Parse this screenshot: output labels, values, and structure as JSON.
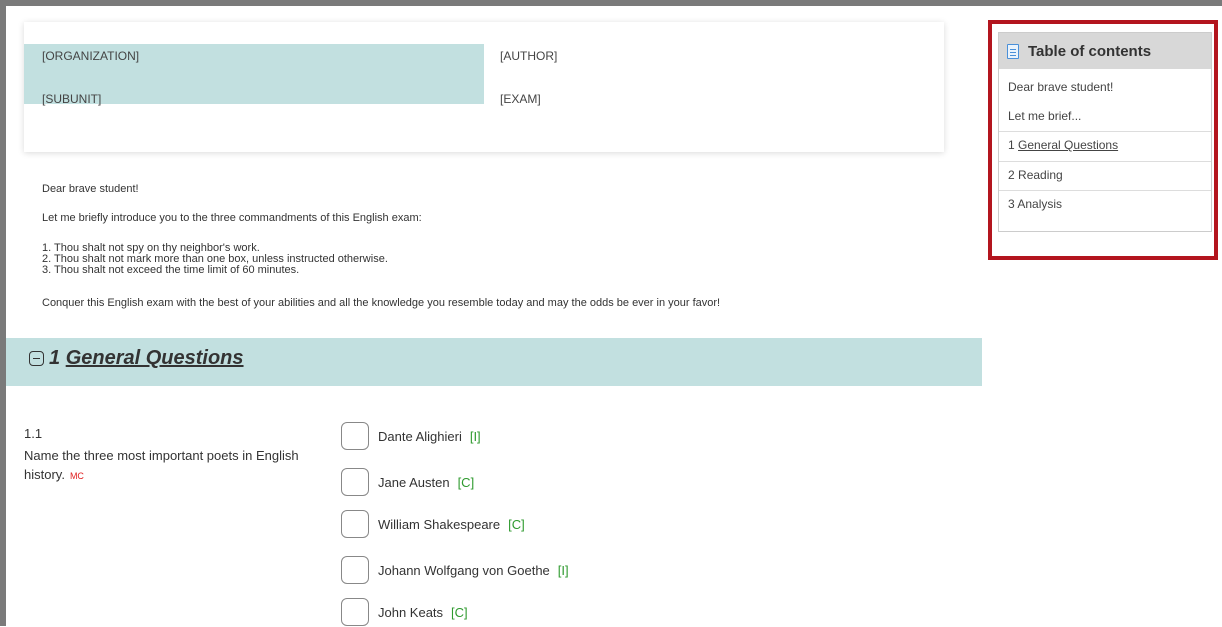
{
  "header": {
    "organization": "[ORGANIZATION]",
    "author": "[AUTHOR]",
    "subunit": "[SUBUNIT]",
    "exam": "[EXAM]"
  },
  "intro": {
    "greeting": "Dear brave student!",
    "lead": "Let me briefly introduce you to the three commandments of this English exam:",
    "rules": [
      "1. Thou shalt not spy on thy neighbor's work.",
      "2. Thou shalt not mark more than one box, unless instructed otherwise.",
      "3. Thou shalt not exceed the time limit of 60 minutes."
    ],
    "closing": "Conquer this English exam with the best of your abilities and all the knowledge you resemble today and may the odds be ever in your favor!"
  },
  "section": {
    "number": "1",
    "title": "General Questions"
  },
  "question": {
    "number": "1.1",
    "text": "Name the three most important poets in English history.",
    "type_badge": "MC",
    "options": [
      {
        "label": "Dante Alighieri",
        "tag": "[I]"
      },
      {
        "label": "Jane Austen",
        "tag": "[C]"
      },
      {
        "label": "William Shakespeare",
        "tag": "[C]"
      },
      {
        "label": "Johann Wolfgang von Goethe",
        "tag": "[I]"
      },
      {
        "label": "John Keats",
        "tag": "[C]"
      }
    ]
  },
  "toc": {
    "title": "Table of contents",
    "items": [
      {
        "text": "Dear brave student!"
      },
      {
        "text": "Let me brief..."
      },
      {
        "num": "1",
        "text": "General Questions"
      },
      {
        "num": "2",
        "text": "Reading"
      },
      {
        "num": "3",
        "text": "Analysis"
      }
    ]
  },
  "colors": {
    "accent_teal": "#c2e0e0",
    "highlight_red": "#b3151e",
    "tag_green": "#2e9a2e",
    "mc_red": "#e02020"
  }
}
